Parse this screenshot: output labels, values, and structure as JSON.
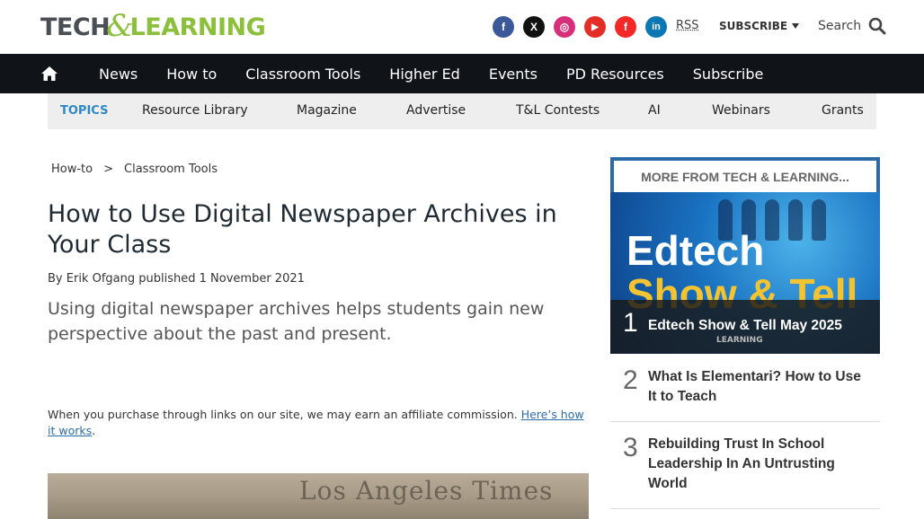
{
  "brand": {
    "name_part1": "TECH",
    "name_amp": "&",
    "name_part2": "LEARNING"
  },
  "header": {
    "socials": [
      {
        "name": "facebook-icon",
        "glyph": "f",
        "color": "#3b5998"
      },
      {
        "name": "x-icon",
        "glyph": "X",
        "color": "#111111"
      },
      {
        "name": "instagram-icon",
        "glyph": "◎",
        "color": "#d6307a"
      },
      {
        "name": "youtube-icon",
        "glyph": "▶",
        "color": "#e52d27"
      },
      {
        "name": "flipboard-icon",
        "glyph": "f",
        "color": "#f52828"
      },
      {
        "name": "linkedin-icon",
        "glyph": "in",
        "color": "#0b77b5"
      }
    ],
    "rss_label": "RSS",
    "subscribe_label": "SUBSCRIBE",
    "search_label": "Search"
  },
  "nav": {
    "items": [
      "News",
      "How to",
      "Classroom Tools",
      "Higher Ed",
      "Events",
      "PD Resources",
      "Subscribe"
    ]
  },
  "topics": {
    "label": "TOPICS",
    "items": [
      "Resource Library",
      "Magazine",
      "Advertise",
      "T&L Contests",
      "AI",
      "Webinars",
      "Grants"
    ]
  },
  "article": {
    "breadcrumb": [
      "How-to",
      ">",
      "Classroom Tools"
    ],
    "title": "How to Use Digital Newspaper Archives in Your Class",
    "byline_prefix": "By",
    "author": "Erik Ofgang",
    "published_label": "published",
    "date": "1 November 2021",
    "strapline": "Using digital newspaper archives helps students gain new perspective about the past and present.",
    "affiliate_text": "When you purchase through links on our site, we may earn an affiliate commission.",
    "affiliate_link": "Here’s how it works",
    "affiliate_end": ".",
    "hero_masthead": "Los Angeles Times"
  },
  "sidebar": {
    "heading": "MORE FROM TECH & LEARNING...",
    "image_text_1": "Edtech",
    "image_text_2": "Show & Tell",
    "image_text_3": "LEARNING",
    "items": [
      {
        "rank": "1",
        "title": "Edtech Show & Tell May 2025"
      },
      {
        "rank": "2",
        "title": "What Is Elementari? How to Use It to Teach"
      },
      {
        "rank": "3",
        "title": "Rebuilding Trust In School Leadership In An Untrusting World"
      }
    ]
  }
}
